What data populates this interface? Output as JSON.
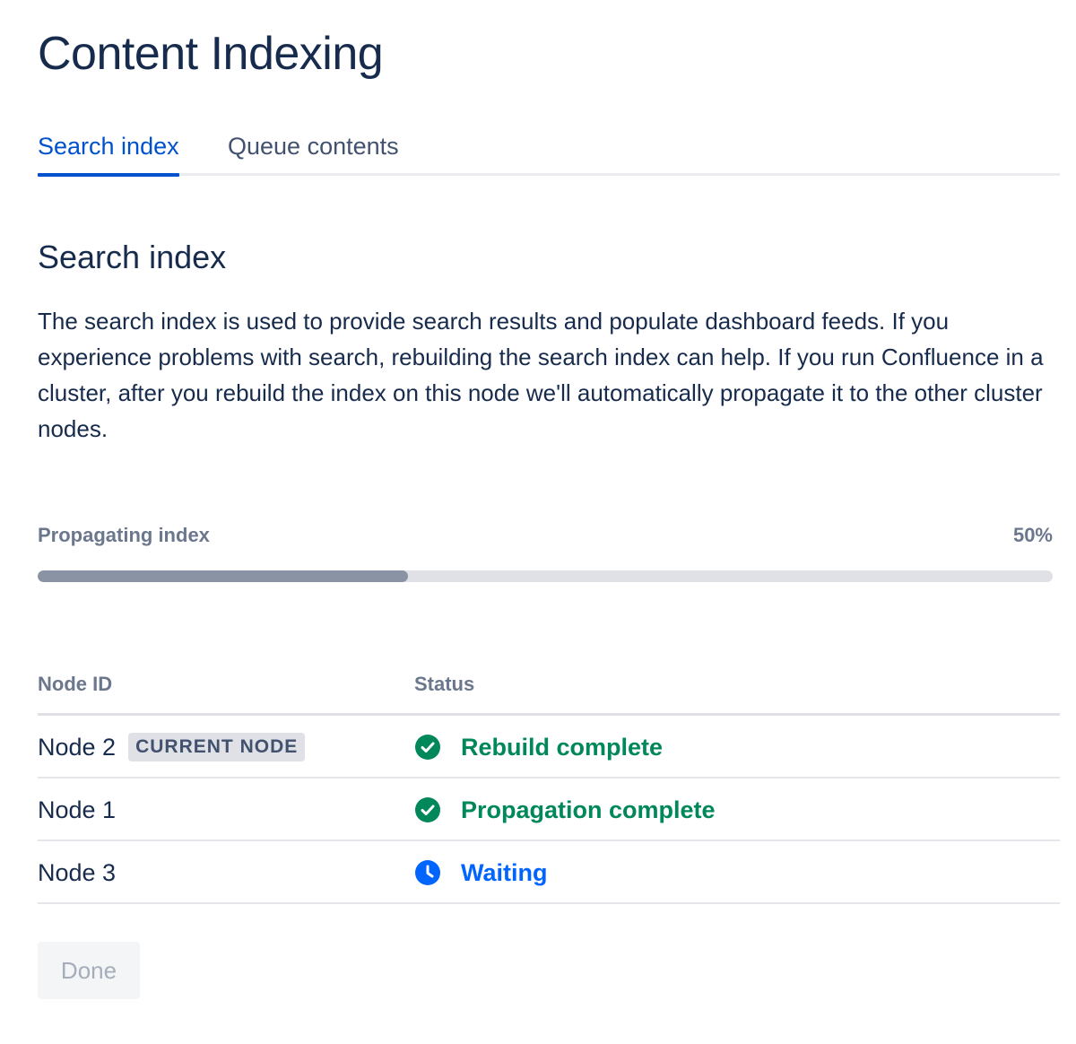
{
  "page_title": "Content Indexing",
  "tabs": [
    {
      "label": "Search index",
      "active": true
    },
    {
      "label": "Queue contents",
      "active": false
    }
  ],
  "section": {
    "title": "Search index",
    "description": "The search index is used to provide search results and populate dashboard feeds. If you experience problems with search, rebuilding the search index can help. If you run Confluence in a cluster, after you rebuild the index on this node we'll automatically propagate it to the other cluster nodes."
  },
  "progress": {
    "label": "Propagating index",
    "percent_text": "50%",
    "value": 0.5
  },
  "table": {
    "headers": {
      "node_id": "Node ID",
      "status": "Status"
    },
    "rows": [
      {
        "node": "Node 2",
        "badge": "CURRENT NODE",
        "status": "Rebuild complete",
        "status_icon": "check-circle-icon",
        "status_color": "#00875a"
      },
      {
        "node": "Node 1",
        "badge": "",
        "status": "Propagation complete",
        "status_icon": "check-circle-icon",
        "status_color": "#00875a"
      },
      {
        "node": "Node 3",
        "badge": "",
        "status": "Waiting",
        "status_icon": "clock-icon",
        "status_color": "#0065ff"
      }
    ]
  },
  "done_button": {
    "label": "Done",
    "disabled": true
  },
  "colors": {
    "primary_text": "#172b4d",
    "accent_blue": "#0052cc",
    "success_green": "#00875a",
    "waiting_blue": "#0065ff",
    "progress_fill": "#8993a4",
    "progress_track": "#dfe1e6"
  }
}
